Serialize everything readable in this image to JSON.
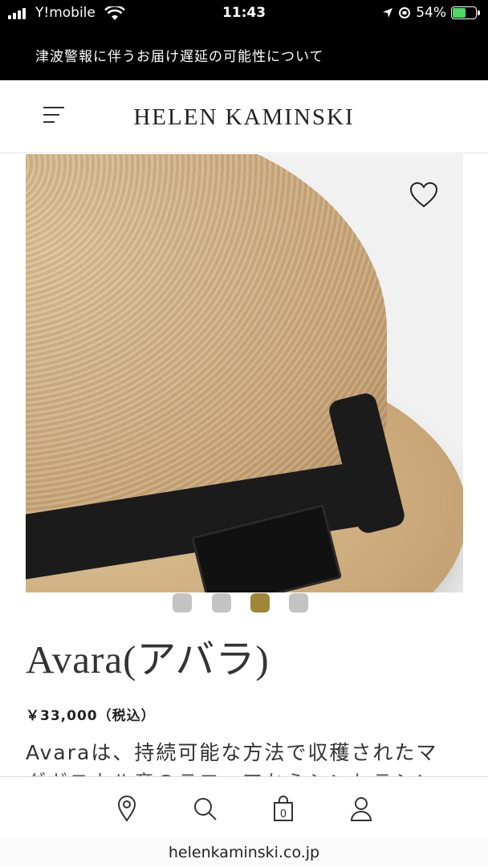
{
  "status_bar": {
    "carrier": "Y!mobile",
    "time": "11:43",
    "battery": "54%"
  },
  "notice": {
    "text": "津波警報に伴うお届け遅延の可能性について"
  },
  "header": {
    "brand": "HELEN KAMINSKI"
  },
  "gallery": {
    "slide_count": 4,
    "active_slide": 3
  },
  "product": {
    "name": "Avara(アバラ)",
    "price": "￥33,000（税込）",
    "description": "Avaraは、持続可能な方法で収穫されたマ",
    "description_cut": "ダガスカル産のラフィアからシンセラシン"
  },
  "tabbar": {
    "items": [
      "location-icon",
      "search-icon",
      "bag-icon",
      "account-icon"
    ]
  },
  "browser": {
    "url": "helenkaminski.co.jp"
  },
  "colors": {
    "accent": "#a08738",
    "dot_inactive": "#c3c3c3"
  }
}
